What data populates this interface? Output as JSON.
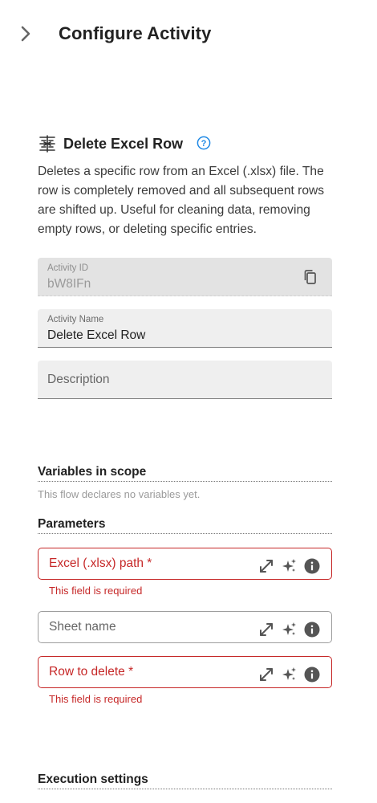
{
  "header": {
    "title": "Configure Activity",
    "collapse_icon": "chevron-right-icon"
  },
  "activity": {
    "icon": "delete-row-icon",
    "title": "Delete Excel Row",
    "help_icon": "help-circle-icon",
    "description": "Deletes a specific row from an Excel (.xlsx) file. The row is completely removed and all subsequent rows are shifted up. Useful for cleaning data, removing empty rows, or deleting specific entries."
  },
  "fields": {
    "activity_id": {
      "label": "Activity ID",
      "value": "bW8IFn",
      "action_icon": "copy-icon"
    },
    "activity_name": {
      "label": "Activity Name",
      "value": "Delete Excel Row"
    },
    "description": {
      "placeholder": "Description"
    }
  },
  "variables": {
    "title": "Variables in scope",
    "empty_text": "This flow declares no variables yet."
  },
  "parameters": {
    "title": "Parameters",
    "items": [
      {
        "label": "Excel (.xlsx) path *",
        "error": "This field is required",
        "required": true
      },
      {
        "label": "Sheet name",
        "error": "",
        "required": false
      },
      {
        "label": "Row to delete *",
        "error": "This field is required",
        "required": true
      }
    ],
    "action_icons": [
      "expand-icon",
      "sparkle-icon",
      "info-icon"
    ]
  },
  "execution": {
    "title": "Execution settings"
  },
  "colors": {
    "error": "#c62828",
    "help": "#1e88e5",
    "field_bg": "#efefef",
    "disabled_bg": "#e3e3e3"
  }
}
